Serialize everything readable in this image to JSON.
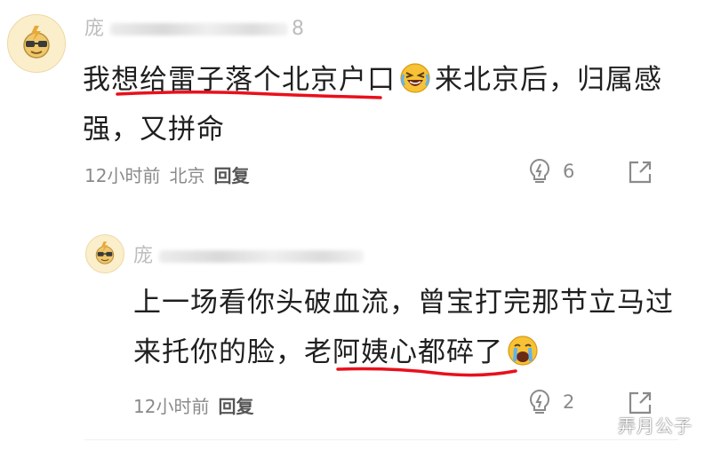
{
  "comments": [
    {
      "username": "庞",
      "username_tail": "8",
      "text_before": "我想",
      "text_marked": "给雷子落个北京户口",
      "text_after_emoji": "来北京后，归属感强，又拼命",
      "emoji": "laughing-crying-emoji",
      "time": "12小时前",
      "location": "北京",
      "reply_label": "回复",
      "likes": "6"
    },
    {
      "username": "庞",
      "text_before": "上一场看你头破血流，曾宝打完那节立马过来托你的脸，",
      "text_marked": "老阿姨心都碎了",
      "emoji": "crying-emoji",
      "time": "12小时前",
      "reply_label": "回复",
      "likes": "2"
    }
  ],
  "watermark": "弄月公子",
  "colors": {
    "underline": "#e8101c",
    "meta": "#8a8a8a",
    "avatar_bg": "#fbeecb"
  }
}
